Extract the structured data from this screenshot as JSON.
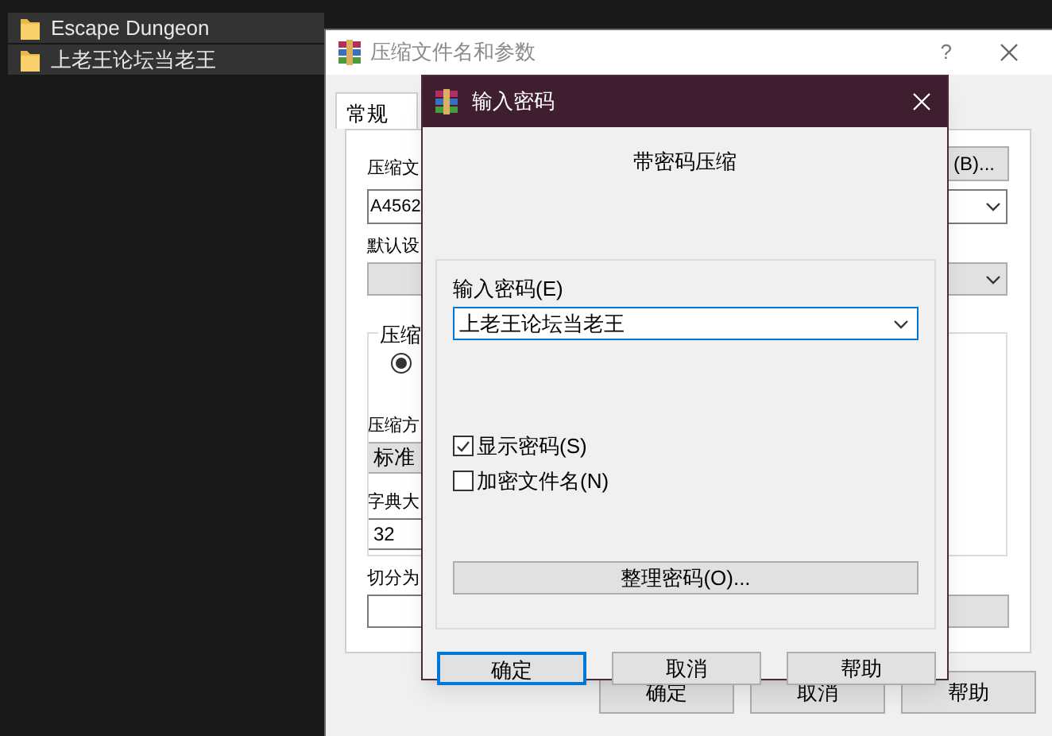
{
  "explorer": {
    "rows": [
      {
        "name": "Escape Dungeon"
      },
      {
        "name": "上老王论坛当老王"
      }
    ]
  },
  "archive_dialog": {
    "title": "压缩文件名和参数",
    "help": "?",
    "tabs": [
      {
        "label": "常规",
        "selected": true
      }
    ],
    "browse_button": "(B)...",
    "archive_name_label": "压缩文",
    "archive_name_value": "A4562",
    "profile_label": "默认设",
    "group_label": "压缩",
    "radio": {
      "selected": true
    },
    "method_label": "压缩方",
    "method_value": "标准",
    "dictionary_label": "字典大",
    "dictionary_value": "32",
    "split_label": "切分为",
    "buttons": [
      "确定",
      "取消",
      "帮助"
    ]
  },
  "password_dialog": {
    "title": "输入密码",
    "heading": "带密码压缩",
    "password_label": "输入密码(E)",
    "password_value": "上老王论坛当老王",
    "checkboxes": [
      {
        "label": "显示密码(S)",
        "checked": true
      },
      {
        "label": "加密文件名(N)",
        "checked": false
      }
    ],
    "organize_button": "整理密码(O)...",
    "buttons": [
      {
        "label": "确定",
        "focused": true
      },
      {
        "label": "取消",
        "focused": false
      },
      {
        "label": "帮助",
        "focused": false
      }
    ]
  }
}
